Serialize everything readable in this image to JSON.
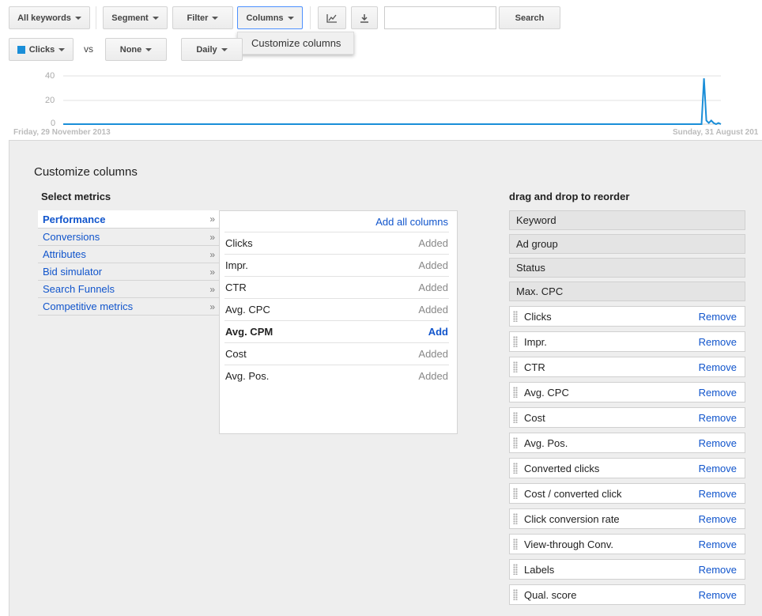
{
  "toolbar": {
    "all_keywords": "All keywords",
    "segment": "Segment",
    "filter": "Filter",
    "columns": "Columns",
    "search_value": "",
    "search_button": "Search",
    "chart_icon": "line-chart-icon",
    "download_icon": "download-icon"
  },
  "columns_menu": {
    "item": "Customize columns"
  },
  "metrics_bar": {
    "metric1": "Clicks",
    "metric1_color": "#1a8ed8",
    "vs": "vs",
    "metric2": "None",
    "interval": "Daily"
  },
  "chart": {
    "y_ticks": [
      "40",
      "20",
      "0"
    ],
    "start_date": "Friday, 29 November 2013",
    "end_date": "Sunday, 31 August 201"
  },
  "chart_data": {
    "type": "line",
    "series": [
      {
        "values": [
          0,
          0,
          0,
          0,
          0,
          0,
          0,
          0,
          0,
          0,
          0,
          0,
          0,
          0,
          0,
          0,
          0,
          0,
          0,
          0,
          0,
          0,
          0,
          0,
          0,
          0,
          0,
          0,
          0,
          0,
          0,
          0,
          0,
          0,
          0,
          0,
          0,
          0,
          0,
          0,
          0,
          0,
          0,
          0,
          0,
          0,
          0,
          0,
          0,
          0,
          0,
          0,
          0,
          0,
          0,
          0,
          0,
          0,
          0,
          0,
          0,
          0,
          0,
          0,
          0,
          0,
          0,
          0,
          0,
          0,
          0,
          0,
          0,
          0,
          0,
          0,
          0,
          0,
          0,
          0,
          0,
          0,
          0,
          0,
          0,
          0,
          0,
          0,
          0,
          0,
          0,
          0,
          0,
          0,
          0,
          0,
          0,
          0,
          0,
          0,
          0,
          0,
          0,
          0,
          0,
          0,
          0,
          0,
          0,
          0,
          0,
          0,
          0,
          0,
          0,
          0,
          0,
          0,
          0,
          0,
          0,
          0,
          0,
          0,
          0,
          0,
          0,
          0,
          0,
          0,
          0,
          0,
          0,
          0,
          0,
          0,
          0,
          0,
          0,
          0,
          0,
          0,
          0,
          0,
          0,
          0,
          0,
          0,
          0,
          0,
          0,
          0,
          0,
          0,
          0,
          0,
          0,
          0,
          0,
          0,
          0,
          0,
          0,
          0,
          0,
          0,
          0,
          0,
          0,
          0,
          0,
          0,
          0,
          0,
          0,
          0,
          0,
          0,
          0,
          0,
          0,
          0,
          0,
          0,
          0,
          0,
          0,
          0,
          0,
          0,
          0,
          0,
          0,
          0,
          0,
          0,
          0,
          0,
          0,
          0,
          0,
          0,
          0,
          0,
          0,
          0,
          0,
          0,
          0,
          0,
          0,
          0,
          0,
          0,
          0,
          0,
          0,
          0,
          0,
          0,
          0,
          0,
          0,
          0,
          0,
          0,
          0,
          0,
          0,
          0,
          0,
          0,
          0,
          0,
          0,
          0,
          0,
          0,
          0,
          0,
          0,
          0,
          0,
          0,
          0,
          0,
          0,
          0,
          0,
          0,
          0,
          0,
          0,
          0,
          0,
          0,
          0,
          0,
          0,
          0,
          0,
          0,
          0,
          0,
          0,
          38,
          3,
          1,
          3,
          1,
          0,
          1,
          0
        ]
      }
    ],
    "ylim": [
      0,
      40
    ],
    "grid": true
  },
  "customize": {
    "title": "Customize columns",
    "select_metrics": "Select metrics",
    "categories": [
      {
        "label": "Performance",
        "selected": true
      },
      {
        "label": "Conversions",
        "selected": false
      },
      {
        "label": "Attributes",
        "selected": false
      },
      {
        "label": "Bid simulator",
        "selected": false
      },
      {
        "label": "Search Funnels",
        "selected": false
      },
      {
        "label": "Competitive metrics",
        "selected": false
      }
    ],
    "add_all": "Add all columns",
    "metrics": [
      {
        "name": "Clicks",
        "status": "Added",
        "addable": false
      },
      {
        "name": "Impr.",
        "status": "Added",
        "addable": false
      },
      {
        "name": "CTR",
        "status": "Added",
        "addable": false
      },
      {
        "name": "Avg. CPC",
        "status": "Added",
        "addable": false
      },
      {
        "name": "Avg. CPM",
        "status": "Add",
        "addable": true
      },
      {
        "name": "Cost",
        "status": "Added",
        "addable": false
      },
      {
        "name": "Avg. Pos.",
        "status": "Added",
        "addable": false
      }
    ],
    "reorder_title": "drag and drop to reorder",
    "fixed_columns": [
      "Keyword",
      "Ad group",
      "Status",
      "Max. CPC"
    ],
    "remove_label": "Remove",
    "added_columns": [
      "Clicks",
      "Impr.",
      "CTR",
      "Avg. CPC",
      "Cost",
      "Avg. Pos.",
      "Converted clicks",
      "Cost / converted click",
      "Click conversion rate",
      "View-through Conv.",
      "Labels",
      "Qual. score"
    ]
  }
}
